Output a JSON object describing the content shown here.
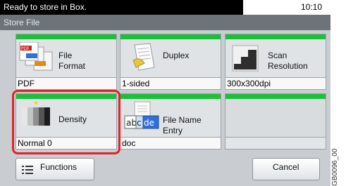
{
  "status": {
    "message": "Ready to store in Box.",
    "time": "10:10"
  },
  "screen_title": "Store File",
  "tiles": [
    {
      "label": "File\nFormat",
      "value": "PDF",
      "icon": "file-format-icon"
    },
    {
      "label": "Duplex",
      "value": "1-sided",
      "icon": "duplex-icon"
    },
    {
      "label": "Scan\nResolution",
      "value": "300x300dpi",
      "icon": "scan-resolution-icon"
    },
    {
      "label": "Density",
      "value": "Normal 0",
      "icon": "density-icon"
    },
    {
      "label": "File Name\nEntry",
      "value": "doc",
      "icon": "file-name-icon"
    }
  ],
  "buttons": {
    "functions": "Functions",
    "cancel": "Cancel"
  },
  "figure_code": "GB0096_00",
  "colors": {
    "accent_bar": "#1dbf3a",
    "highlight": "#e0252a"
  }
}
